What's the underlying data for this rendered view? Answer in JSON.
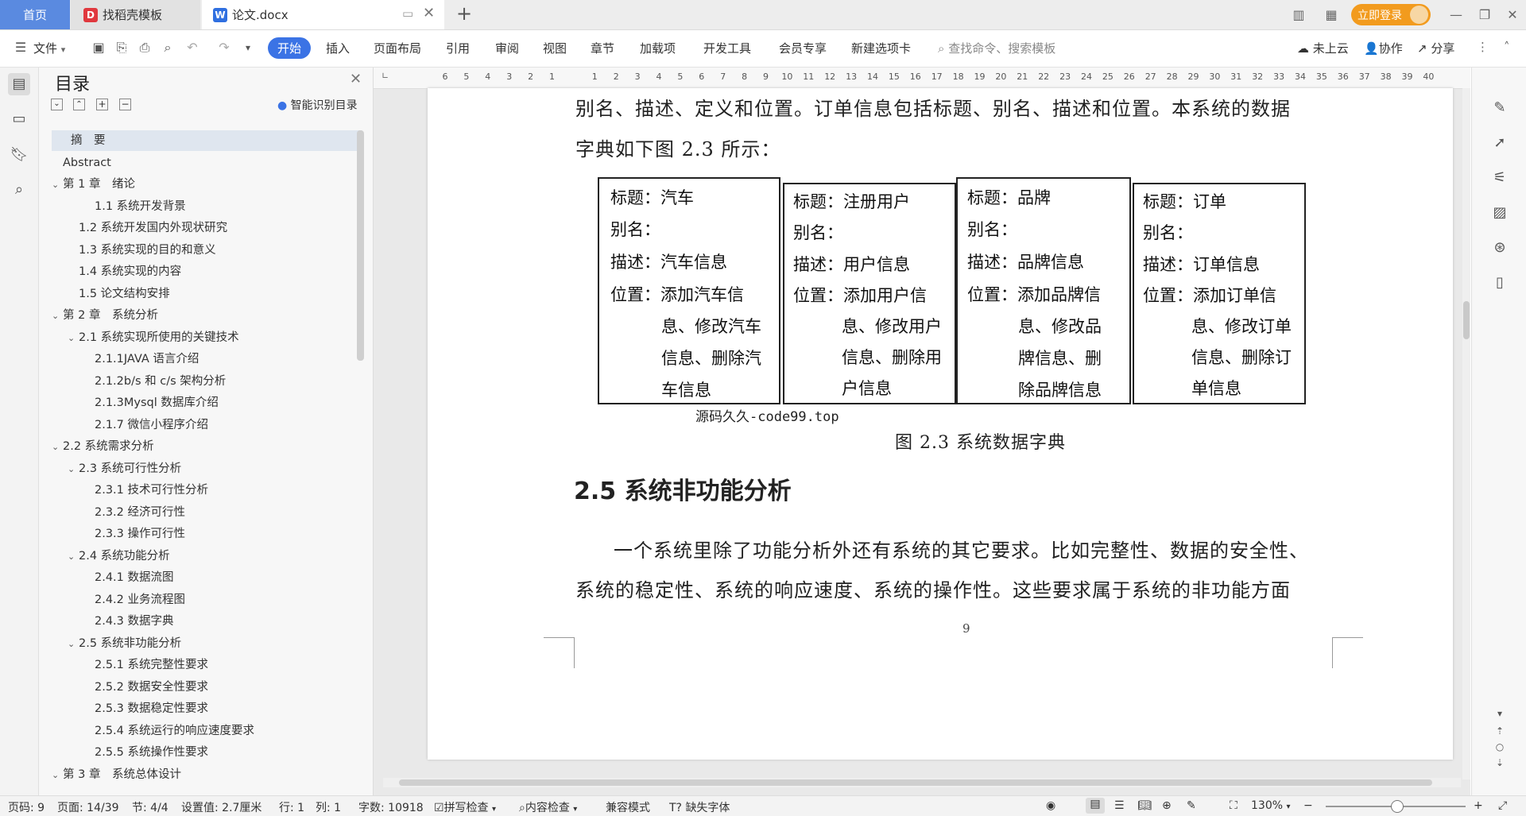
{
  "tabs": {
    "home": "首页",
    "template": "找稻壳模板",
    "document": "论文.docx",
    "login": "立即登录"
  },
  "ribbon": {
    "file": "文件",
    "items": [
      "开始",
      "插入",
      "页面布局",
      "引用",
      "审阅",
      "视图",
      "章节",
      "加载项",
      "开发工具",
      "会员专享",
      "新建选项卡"
    ],
    "search_placeholder": "查找命令、搜索模板",
    "cloud": "未上云",
    "collab": "协作",
    "share": "分享"
  },
  "toc": {
    "title": "目录",
    "smart": "智能识别目录",
    "items": [
      {
        "label": "摘　要",
        "level": 0,
        "arrow": ""
      },
      {
        "label": "Abstract",
        "level": 0,
        "arrow": ""
      },
      {
        "label": "第 1 章　绪论",
        "level": 0,
        "arrow": "v"
      },
      {
        "label": "1.1 系统开发背景",
        "level": 2,
        "arrow": ""
      },
      {
        "label": "1.2 系统开发国内外现状研究",
        "level": 1,
        "arrow": ""
      },
      {
        "label": "1.3 系统实现的目的和意义",
        "level": 1,
        "arrow": ""
      },
      {
        "label": "1.4 系统实现的内容",
        "level": 1,
        "arrow": ""
      },
      {
        "label": "1.5 论文结构安排",
        "level": 1,
        "arrow": ""
      },
      {
        "label": "第 2 章　系统分析",
        "level": 0,
        "arrow": "v"
      },
      {
        "label": "2.1 系统实现所使用的关键技术",
        "level": 1,
        "arrow": "v"
      },
      {
        "label": "2.1.1JAVA 语言介绍",
        "level": 2,
        "arrow": ""
      },
      {
        "label": "2.1.2b/s 和 c/s 架构分析",
        "level": 2,
        "arrow": ""
      },
      {
        "label": "2.1.3Mysql 数据库介绍",
        "level": 2,
        "arrow": ""
      },
      {
        "label": "2.1.7 微信小程序介绍",
        "level": 2,
        "arrow": ""
      },
      {
        "label": "2.2 系统需求分析",
        "level": 0,
        "arrow": "v"
      },
      {
        "label": "2.3 系统可行性分析",
        "level": 1,
        "arrow": "v"
      },
      {
        "label": "2.3.1 技术可行性分析",
        "level": 2,
        "arrow": ""
      },
      {
        "label": "2.3.2 经济可行性",
        "level": 2,
        "arrow": ""
      },
      {
        "label": "2.3.3 操作可行性",
        "level": 2,
        "arrow": ""
      },
      {
        "label": "2.4 系统功能分析",
        "level": 1,
        "arrow": "v"
      },
      {
        "label": "2.4.1 数据流图",
        "level": 2,
        "arrow": ""
      },
      {
        "label": "2.4.2  业务流程图",
        "level": 2,
        "arrow": ""
      },
      {
        "label": "2.4.3 数据字典",
        "level": 2,
        "arrow": ""
      },
      {
        "label": "2.5  系统非功能分析",
        "level": 1,
        "arrow": "v"
      },
      {
        "label": "2.5.1 系统完整性要求",
        "level": 2,
        "arrow": ""
      },
      {
        "label": "2.5.2 数据安全性要求",
        "level": 2,
        "arrow": ""
      },
      {
        "label": "2.5.3 数据稳定性要求",
        "level": 2,
        "arrow": ""
      },
      {
        "label": "2.5.4 系统运行的响应速度要求",
        "level": 2,
        "arrow": ""
      },
      {
        "label": "2.5.5 系统操作性要求",
        "level": 2,
        "arrow": ""
      },
      {
        "label": "第 3 章　系统总体设计",
        "level": 0,
        "arrow": "v"
      }
    ]
  },
  "ruler": [
    "6",
    "5",
    "4",
    "3",
    "2",
    "1",
    "",
    "1",
    "2",
    "3",
    "4",
    "5",
    "6",
    "7",
    "8",
    "9",
    "10",
    "11",
    "12",
    "13",
    "14",
    "15",
    "16",
    "17",
    "18",
    "19",
    "20",
    "21",
    "22",
    "23",
    "24",
    "25",
    "26",
    "27",
    "28",
    "29",
    "30",
    "31",
    "32",
    "33",
    "34",
    "35",
    "36",
    "37",
    "38",
    "39",
    "40"
  ],
  "doc": {
    "line1": "别名、描述、定义和位置。订单信息包括标题、别名、描述和位置。本系统的数据",
    "line2": "字典如下图 2.3 所示：",
    "boxes": [
      {
        "title": "标题：汽车",
        "alias": "别名：",
        "desc": "描述：汽车信息",
        "pos": "位置：添加汽车信",
        "cont": [
          "息、修改汽车",
          "信息、删除汽",
          "车信息"
        ]
      },
      {
        "title": "标题：注册用户",
        "alias": "别名：",
        "desc": "描述：用户信息",
        "pos": "位置：添加用户信",
        "cont": [
          "息、修改用户",
          "信息、删除用",
          "户信息"
        ]
      },
      {
        "title": "标题：品牌",
        "alias": "别名：",
        "desc": "描述：品牌信息",
        "pos": "位置：添加品牌信",
        "cont": [
          "息、修改品",
          "牌信息、删",
          "除品牌信息"
        ]
      },
      {
        "title": "标题：订单",
        "alias": "别名：",
        "desc": "描述：订单信息",
        "pos": "位置：添加订单信",
        "cont": [
          "息、修改订单",
          "信息、删除订",
          "单信息"
        ]
      }
    ],
    "watermark": "源码久久-code99.top",
    "caption": "图 2.3 系统数据字典",
    "heading": "2.5  系统非功能分析",
    "body1": "一个系统里除了功能分析外还有系统的其它要求。比如完整性、数据的安全性、",
    "body2": "系统的稳定性、系统的响应速度、系统的操作性。这些要求属于系统的非功能方面",
    "page_num": "9"
  },
  "status": {
    "page": "页码: 9",
    "pages": "页面: 14/39",
    "section": "节: 4/4",
    "setting": "设置值: 2.7厘米",
    "row": "行: 1",
    "col": "列: 1",
    "words": "字数: 10918",
    "spell": "拼写检查",
    "content": "内容检查",
    "compat": "兼容模式",
    "font": "缺失字体",
    "zoom": "130%"
  }
}
